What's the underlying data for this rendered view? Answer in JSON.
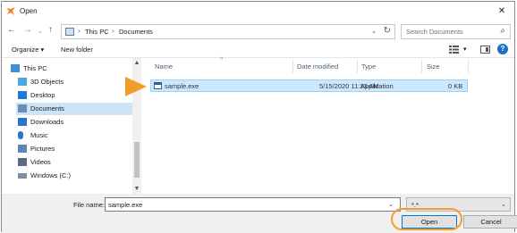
{
  "window": {
    "title": "Open",
    "close_glyph": "✕"
  },
  "address": {
    "back_glyph": "←",
    "forward_glyph": "→",
    "history_glyph": "⌄",
    "up_glyph": "↑",
    "crumbs": [
      "This PC",
      "Documents"
    ],
    "crumb_sep": "›",
    "dropdown_glyph": "⌄",
    "refresh_glyph": "↻"
  },
  "search": {
    "placeholder": "Search Documents",
    "icon_glyph": "⌕"
  },
  "toolbar": {
    "organize_label": "Organize ▾",
    "new_folder_label": "New folder",
    "view_dropdown_glyph": "▾",
    "help_glyph": "?"
  },
  "sidebar": {
    "items": [
      {
        "label": "This PC",
        "icon": "this-pc-icon",
        "color": "#3c8fd8"
      },
      {
        "label": "3D Objects",
        "icon": "3d-objects-icon",
        "color": "#4aa8e0"
      },
      {
        "label": "Desktop",
        "icon": "desktop-icon",
        "color": "#1f7ad6"
      },
      {
        "label": "Documents",
        "icon": "documents-icon",
        "color": "#6b8db8",
        "selected": true
      },
      {
        "label": "Downloads",
        "icon": "downloads-icon",
        "color": "#2a73c9"
      },
      {
        "label": "Music",
        "icon": "music-icon",
        "color": "#2a73c9"
      },
      {
        "label": "Pictures",
        "icon": "pictures-icon",
        "color": "#5b86b5"
      },
      {
        "label": "Videos",
        "icon": "videos-icon",
        "color": "#5b6b80"
      },
      {
        "label": "Windows (C:)",
        "icon": "drive-icon",
        "color": "#7a8ea8"
      }
    ],
    "scroll_up_glyph": "▲",
    "scroll_down_glyph": "▼"
  },
  "filelist": {
    "columns": [
      "Name",
      "Date modified",
      "Type",
      "Size"
    ],
    "sort_glyph": "^",
    "rows": [
      {
        "name": "sample.exe",
        "date": "5/15/2020 11:23 AM",
        "type": "Application",
        "size": "0 KB"
      }
    ]
  },
  "bottom": {
    "file_name_label": "File name:",
    "file_name_value": "sample.exe",
    "file_name_dropdown_glyph": "⌄",
    "filter_value": "*.*",
    "filter_dropdown_glyph": "⌄",
    "open_label": "Open",
    "cancel_label": "Cancel"
  },
  "colors": {
    "accent": "#f39c2e",
    "selection": "#cce8ff",
    "primary_border": "#0078d7"
  }
}
